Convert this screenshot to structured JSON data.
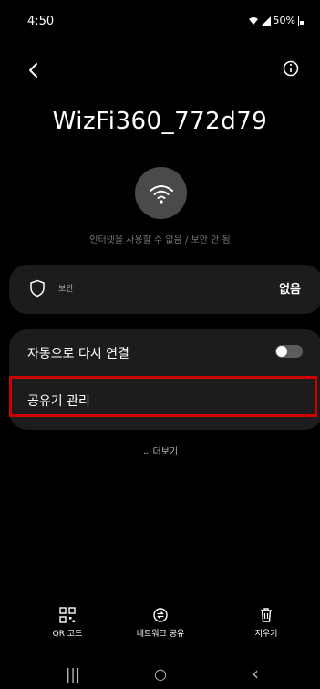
{
  "status_bar": {
    "time": "4:50",
    "battery": "50%"
  },
  "network": {
    "ssid": "WizFi360_772d79",
    "status": "인터넷을 사용할 수 없음 / 보안 안 됨"
  },
  "security": {
    "label": "보안",
    "value": "없음"
  },
  "settings": {
    "auto_reconnect_label": "자동으로 다시 연결",
    "auto_reconnect_on": false,
    "router_manage_label": "공유기 관리"
  },
  "more_label": "더보기",
  "actions": [
    {
      "label": "QR 코드",
      "icon": "qr-code-icon"
    },
    {
      "label": "네트워크 공유",
      "icon": "share-network-icon"
    },
    {
      "label": "지우기",
      "icon": "trash-icon"
    }
  ],
  "nav": {
    "recents": "|||",
    "home": "○",
    "back": "‹"
  },
  "colors": {
    "highlight": "#d10000",
    "card": "#1c1c1e",
    "wifi_circle": "#4a4a4a"
  }
}
